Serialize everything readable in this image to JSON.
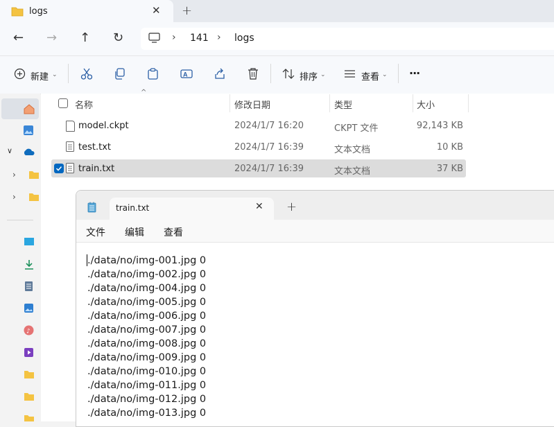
{
  "explorer": {
    "tab_title": "logs",
    "tab_close": "✕",
    "new_tab": "+",
    "breadcrumb": [
      "141",
      "logs"
    ],
    "crumb_separator": "›",
    "toolbar": {
      "new_label": "新建",
      "sort_label": "排序",
      "view_label": "查看",
      "more_label": "···"
    },
    "columns": {
      "name": "名称",
      "date": "修改日期",
      "type": "类型",
      "size": "大小"
    },
    "files": [
      {
        "name": "model.ckpt",
        "date": "2024/1/7 16:20",
        "type": "CKPT 文件",
        "size": "92,143 KB"
      },
      {
        "name": "test.txt",
        "date": "2024/1/7 16:39",
        "type": "文本文档",
        "size": "10 KB"
      },
      {
        "name": "train.txt",
        "date": "2024/1/7 16:39",
        "type": "文本文档",
        "size": "37 KB",
        "selected": true
      }
    ]
  },
  "notepad": {
    "tab_title": "train.txt",
    "tab_close": "✕",
    "new_tab": "+",
    "menu": {
      "file": "文件",
      "edit": "编辑",
      "view": "查看"
    },
    "content": "./data/no/img-001.jpg 0\n./data/no/img-002.jpg 0\n./data/no/img-004.jpg 0\n./data/no/img-005.jpg 0\n./data/no/img-006.jpg 0\n./data/no/img-007.jpg 0\n./data/no/img-008.jpg 0\n./data/no/img-009.jpg 0\n./data/no/img-010.jpg 0\n./data/no/img-011.jpg 0\n./data/no/img-012.jpg 0\n./data/no/img-013.jpg 0"
  },
  "colors": {
    "accent": "#0067c0",
    "folder": "#f4c342",
    "selection": "#dcdcdc"
  }
}
